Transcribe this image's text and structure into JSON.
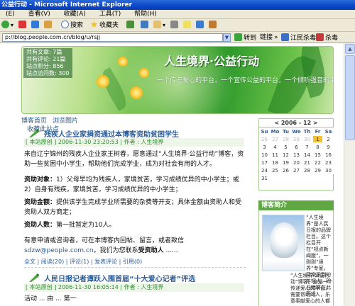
{
  "window": {
    "title": "公益行动 - Microsoft Internet Explorer"
  },
  "menu": [
    "(E)",
    "查看(V)",
    "收藏(A)",
    "工具(T)",
    "帮助(H)"
  ],
  "toolbar": {
    "search": "搜索",
    "favorites": "收藏夹"
  },
  "address": {
    "url": "p://blog.people.com.cn/blog/u/rsjj",
    "go": "转到",
    "links": "链接",
    "extra1": "江民杀毒",
    "extra2": "杀毒"
  },
  "banner": {
    "stats": [
      "共有文章: 7篇",
      "共有评论: 21篇",
      "站点积分: 856",
      "站点访问数: 300"
    ],
    "title": "人生境界·公益行动",
    "subtitle": "一个传递爱心的平台，一个宣传公益的平台，一个倾听强音的平台",
    "nav": [
      "博客首页",
      "浏览图片",
      "收藏此站点"
    ]
  },
  "posts": [
    {
      "title": "残疾人企业家捐资通过本博客资助贫困学生",
      "meta": "[ 本站原创 ] 2006-11-30 23:20:53 | 作者 : 人生境界",
      "p1": "来自辽宁锦州的残疾人企业家王树春，愿意通过“人生境界·公益行动”博客，资助一些贫困中小学生，帮助他们完成学业，成为对社会有用的人才。",
      "p2_label": "资助对象：",
      "p2_text": "1）父母早均为残疾人，家境贫苦，学习成绩优异的中小学生；或2）自身有残疾，家境贫苦，学习成绩优异的中小学生；",
      "p3_label": "资助金额：",
      "p3_text": "提供该学生完成学业所需要的杂费等开支；具体金额由资助人和受资助人双方商定；",
      "p4_label": "资助人数：",
      "p4_text": "第一批暂定为10人。",
      "p5": "有意申请或咨询者，可在本博客内回帖、留言，或者致信",
      "p5_email": "sdzw@people.com.cn",
      "p5_end": "。我们为您联系",
      "p5_bold": "受资助人",
      "p5_tail": "......",
      "links": "全文 | 阅读(20) | 评论(1) | 发表评论 | 引用(0)"
    },
    {
      "title": "人民日报记者谭跃入围首届“十大爱心记者”评选",
      "meta": "[ 本站原创 ] 2006-11-30 16:05:14 | 作者 : 人生境界",
      "p1": "活动 ... 由 ... 第一"
    }
  ],
  "calendar": {
    "header": "<    2006 - 12 >",
    "day_names": [
      "Su",
      "Mo",
      "Tu",
      "We",
      "Th",
      "Fr",
      "Sa"
    ],
    "days": [
      "26",
      "27",
      "28",
      "29",
      "30",
      "1",
      "2",
      "3",
      "4",
      "5",
      "6",
      "7",
      "8",
      "9",
      "10",
      "11",
      "12",
      "13",
      "14",
      "15",
      "16",
      "17",
      "18",
      "19",
      "20",
      "21",
      "22",
      "23",
      "24",
      "25",
      "26",
      "27",
      "28",
      "29",
      "30",
      "31"
    ],
    "today": "1"
  },
  "sidebar": {
    "intro_title": "博客简介",
    "intro_text_right": "“人生境界”是人民日报的品牌栏目。这个栏目开在“视点新闻版”，一则则“境界”专家，又常采到的年轻人，即日始将在此开设",
    "intro_text_bottom": "“人生境界·公益行动”博客。这是一个传递爱心的平台，需要帮助的人，乐意奉献爱心的人都"
  }
}
